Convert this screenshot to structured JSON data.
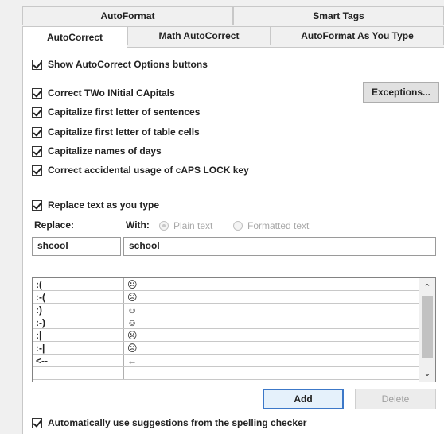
{
  "tabs_row1": [
    {
      "label": "AutoFormat"
    },
    {
      "label": "Smart Tags"
    }
  ],
  "tabs_row2": [
    {
      "label": "AutoCorrect",
      "active": true
    },
    {
      "label": "Math AutoCorrect"
    },
    {
      "label": "AutoFormat As You Type"
    }
  ],
  "options": {
    "show_buttons": "Show AutoCorrect Options buttons",
    "two_initial_caps": "Correct TWo INitial CApitals",
    "first_letter_sentences": "Capitalize first letter of sentences",
    "first_letter_table": "Capitalize first letter of table cells",
    "names_of_days": "Capitalize names of days",
    "caps_lock": "Correct accidental usage of cAPS LOCK key",
    "replace_as_you_type": "Replace text as you type",
    "auto_suggestions": "Automatically use suggestions from the spelling checker"
  },
  "buttons": {
    "exceptions": "Exceptions...",
    "add": "Add",
    "delete": "Delete"
  },
  "replace": {
    "replace_label": "Replace:",
    "with_label": "With:",
    "plain_text": "Plain text",
    "formatted_text": "Formatted text",
    "replace_value": "shcool",
    "with_value": "school"
  },
  "entries": [
    {
      "from": ":(",
      "to": "☹"
    },
    {
      "from": ":-(",
      "to": "☹"
    },
    {
      "from": ":)",
      "to": "☺"
    },
    {
      "from": ":-)",
      "to": "☺"
    },
    {
      "from": ":|",
      "to": "☹"
    },
    {
      "from": ":-|",
      "to": "☹"
    },
    {
      "from": "<--",
      "to": "←"
    }
  ],
  "colors": {
    "accent": "#3c78c8",
    "panel": "#ffffff",
    "dialog": "#f0f0f0"
  }
}
